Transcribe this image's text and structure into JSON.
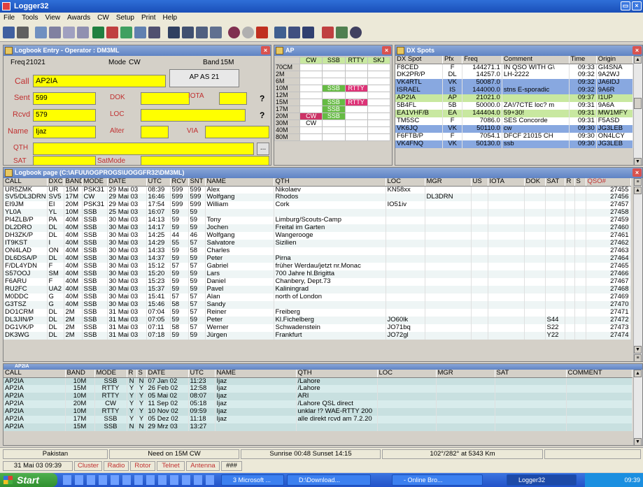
{
  "window": {
    "title": "Logger32"
  },
  "menu": [
    "File",
    "Tools",
    "View",
    "Awards",
    "CW",
    "Setup",
    "Print",
    "Help"
  ],
  "entry": {
    "title": "Logbook Entry - Operator : DM3ML",
    "freq_label": "Freq",
    "freq": "21021",
    "mode_label": "Mode",
    "mode": "CW",
    "band_label": "Band",
    "band": "15M",
    "call_label": "Call",
    "call": "AP2IA",
    "country": "AP AS 21",
    "sent_label": "Sent",
    "sent": "599",
    "rcvd_label": "Rcvd",
    "rcvd": "579",
    "name_label": "Name",
    "name": "Ijaz",
    "qth_label": "QTH",
    "sat_label": "SAT",
    "dok_label": "DOK",
    "loc_label": "LOC",
    "alter_label": "Alter",
    "iota_label": "IOTA",
    "via_label": "VIA",
    "satmode_label": "SatMode",
    "qm": "?"
  },
  "ap": {
    "title": "AP",
    "cols": [
      "CW",
      "SSB",
      "RTTY",
      "SKJ"
    ],
    "rows": [
      {
        "band": "70CM",
        "cells": [
          "",
          "",
          "",
          ""
        ]
      },
      {
        "band": "2M",
        "cells": [
          "",
          "",
          "",
          ""
        ]
      },
      {
        "band": "6M",
        "cells": [
          "",
          "",
          "",
          ""
        ]
      },
      {
        "band": "10M",
        "cells": [
          "",
          "SSB",
          "RTTY",
          ""
        ]
      },
      {
        "band": "12M",
        "cells": [
          "",
          "",
          "",
          ""
        ]
      },
      {
        "band": "15M",
        "cells": [
          "",
          "SSB",
          "RTTY",
          ""
        ]
      },
      {
        "band": "17M",
        "cells": [
          "",
          "SSB",
          "",
          ""
        ]
      },
      {
        "band": "20M",
        "cells": [
          "CW",
          "SSB",
          "",
          ""
        ]
      },
      {
        "band": "30M",
        "cells": [
          "CW",
          "",
          "",
          ""
        ]
      },
      {
        "band": "40M",
        "cells": [
          "",
          "",
          "",
          ""
        ]
      },
      {
        "band": "80M",
        "cells": [
          "",
          "",
          "",
          ""
        ]
      }
    ]
  },
  "dx": {
    "title": "DX Spots",
    "cols": [
      "DX Spot",
      "Pfx",
      "Freq",
      "Comment",
      "Time",
      "Origin"
    ],
    "rows": [
      [
        "F8CED",
        "F",
        "144271.1",
        "IN QSO WITH G\\",
        "09:33",
        "GI4SNA"
      ],
      [
        "DK2PR/P",
        "DL",
        "14257.0",
        "LH-2222",
        "09:32",
        "9A2WJ"
      ],
      [
        "VK4RTL",
        "VK",
        "50087.0",
        "",
        "09:32",
        "JA6IDJ"
      ],
      [
        "ISRAEL",
        "IS",
        "144000.0",
        "stns E-sporadic",
        "09:32",
        "9A6R"
      ],
      [
        "AP2IA",
        "AP",
        "21021.0",
        "",
        "09:37",
        "I1UP"
      ],
      [
        "5B4FL",
        "5B",
        "50000.0",
        "ZA!/7CTE loc? m",
        "09:31",
        "9A6A"
      ],
      [
        "EA1VHF/B",
        "EA",
        "144404.0",
        "59+30!",
        "09:31",
        "MW1MFY"
      ],
      [
        "TM5SC",
        "F",
        "7086.0",
        "SES Concorde",
        "09:31",
        "F5ASD"
      ],
      [
        "VK6JQ",
        "VK",
        "50110.0",
        "cw",
        "09:30",
        "JG3LEB"
      ],
      [
        "F6FTB/P",
        "F",
        "7054.1",
        "DFCF 21015 CH",
        "09:30",
        "ON4LCY"
      ],
      [
        "VK4FNQ",
        "VK",
        "50130.0",
        "ssb",
        "09:30",
        "JG3LEB"
      ]
    ]
  },
  "logbook": {
    "title": "Logbook page (C:\\AFUU\\OGPROGS\\UOGGFR32\\DM3ML)",
    "cols": [
      "CALL",
      "DXC",
      "BAND",
      "MODE",
      "DATE",
      "UTC",
      "RCV",
      "SNT",
      "NAME",
      "QTH",
      "LOC",
      "MGR",
      "US",
      "IOTA",
      "DOK",
      "SAT",
      "R",
      "S",
      "QSO#"
    ],
    "rows": [
      [
        "UR5ZMK",
        "UR",
        "15M",
        "PSK31",
        "29 Mai 03",
        "08:39",
        "599",
        "599",
        "Alex",
        "Nikolaev",
        "KN58xx",
        "",
        "",
        "",
        "",
        "",
        "",
        "",
        "27455"
      ],
      [
        "SV5/DL3DRN",
        "SV5",
        "17M",
        "CW",
        "29 Mai 03",
        "16:46",
        "599",
        "599",
        "Wolfgang",
        "Rhodos",
        "",
        "DL3DRN",
        "",
        "",
        "",
        "",
        "",
        "",
        "27456"
      ],
      [
        "EI9JM",
        "EI",
        "20M",
        "PSK31",
        "29 Mai 03",
        "17:54",
        "599",
        "599",
        "William",
        "Cork",
        "IO51iv",
        "",
        "",
        "",
        "",
        "",
        "",
        "",
        "27457"
      ],
      [
        "YL0A",
        "YL",
        "10M",
        "SSB",
        "25 Mai 03",
        "16:07",
        "59",
        "59",
        "",
        "",
        "",
        "",
        "",
        "",
        "",
        "",
        "",
        "",
        "27458"
      ],
      [
        "PI4ZLB/P",
        "PA",
        "40M",
        "SSB",
        "30 Mai 03",
        "14:13",
        "59",
        "59",
        "Tony",
        "Limburg/Scouts-Camp",
        "",
        "",
        "",
        "",
        "",
        "",
        "",
        "",
        "27459"
      ],
      [
        "DL2DRO",
        "DL",
        "40M",
        "SSB",
        "30 Mai 03",
        "14:17",
        "59",
        "59",
        "Jochen",
        "Freital im Garten",
        "",
        "",
        "",
        "",
        "",
        "",
        "",
        "",
        "27460"
      ],
      [
        "DH3ZK/P",
        "DL",
        "40M",
        "SSB",
        "30 Mai 03",
        "14:25",
        "44",
        "46",
        "Wolfgang",
        "Wangerooge",
        "",
        "",
        "",
        "",
        "",
        "",
        "",
        "",
        "27461"
      ],
      [
        "IT9KST",
        "I",
        "40M",
        "SSB",
        "30 Mai 03",
        "14:29",
        "55",
        "57",
        "Salvatore",
        "Sizilien",
        "",
        "",
        "",
        "",
        "",
        "",
        "",
        "",
        "27462"
      ],
      [
        "ON4LAD",
        "ON",
        "40M",
        "SSB",
        "30 Mai 03",
        "14:33",
        "59",
        "58",
        "Charles",
        "",
        "",
        "",
        "",
        "",
        "",
        "",
        "",
        "",
        "27463"
      ],
      [
        "DL6DSA/P",
        "DL",
        "40M",
        "SSB",
        "30 Mai 03",
        "14:37",
        "59",
        "59",
        "Peter",
        "Pirna",
        "",
        "",
        "",
        "",
        "",
        "",
        "",
        "",
        "27464"
      ],
      [
        "F/DL4YDN",
        "F",
        "40M",
        "SSB",
        "30 Mai 03",
        "15:12",
        "57",
        "57",
        "Gabriel",
        "früher Werdau/jetzt nr.Monac",
        "",
        "",
        "",
        "",
        "",
        "",
        "",
        "",
        "27465"
      ],
      [
        "S57OOJ",
        "SM",
        "40M",
        "SSB",
        "30 Mai 03",
        "15:20",
        "59",
        "59",
        "Lars",
        "700 Jahre hl.Brigitta",
        "",
        "",
        "",
        "",
        "",
        "",
        "",
        "",
        "27466"
      ],
      [
        "F6ARU",
        "F",
        "40M",
        "SSB",
        "30 Mai 03",
        "15:23",
        "59",
        "59",
        "Daniel",
        "Chanbery, Dept.73",
        "",
        "",
        "",
        "",
        "",
        "",
        "",
        "",
        "27467"
      ],
      [
        "RU2FC",
        "UA2",
        "40M",
        "SSB",
        "30 Mai 03",
        "15:37",
        "59",
        "59",
        "Pavel",
        "Kaliningrad",
        "",
        "",
        "",
        "",
        "",
        "",
        "",
        "",
        "27468"
      ],
      [
        "M0DDC",
        "G",
        "40M",
        "SSB",
        "30 Mai 03",
        "15:41",
        "57",
        "57",
        "Alan",
        "north of London",
        "",
        "",
        "",
        "",
        "",
        "",
        "",
        "",
        "27469"
      ],
      [
        "G3TSZ",
        "G",
        "40M",
        "SSB",
        "30 Mai 03",
        "15:46",
        "58",
        "57",
        "Sandy",
        "",
        "",
        "",
        "",
        "",
        "",
        "",
        "",
        "",
        "27470"
      ],
      [
        "DO1CRM",
        "DL",
        "2M",
        "SSB",
        "31 Mai 03",
        "07:04",
        "59",
        "57",
        "Reiner",
        "Freiberg",
        "",
        "",
        "",
        "",
        "",
        "",
        "",
        "",
        "27471"
      ],
      [
        "DL3JIN/P",
        "DL",
        "2M",
        "SSB",
        "31 Mai 03",
        "07:05",
        "59",
        "59",
        "Peter",
        "Kl.Fichelberg",
        "JO60lk",
        "",
        "",
        "",
        "",
        "S44",
        "",
        "",
        "27472"
      ],
      [
        "DG1VK/P",
        "DL",
        "2M",
        "SSB",
        "31 Mai 03",
        "07:11",
        "58",
        "57",
        "Werner",
        "Schwadenstein",
        "JO71bq",
        "",
        "",
        "",
        "",
        "S22",
        "",
        "",
        "27473"
      ],
      [
        "DK3WG",
        "DL",
        "2M",
        "SSB",
        "31 Mai 03",
        "07:18",
        "59",
        "59",
        "Jürgen",
        "Frankfurt",
        "JO72gl",
        "",
        "",
        "",
        "",
        "Y22",
        "",
        "",
        "27474"
      ]
    ]
  },
  "previous": {
    "title": "AP2IA",
    "cols": [
      "CALL",
      "BAND",
      "MODE",
      "R",
      "S",
      "DATE",
      "UTC",
      "NAME",
      "QTH",
      "LOC",
      "MGR",
      "SAT",
      "COMMENT"
    ],
    "rows": [
      [
        "AP2IA",
        "10M",
        "SSB",
        "N",
        "N",
        "07 Jan 02",
        "11:23",
        "Ijaz",
        "/Lahore",
        "",
        "",
        "",
        ""
      ],
      [
        "AP2IA",
        "15M",
        "RTTY",
        "Y",
        "Y",
        "26 Feb 02",
        "12:58",
        "Ijaz",
        "/Lahore",
        "",
        "",
        "",
        ""
      ],
      [
        "AP2IA",
        "10M",
        "RTTY",
        "Y",
        "Y",
        "05 Mai 02",
        "08:07",
        "Ijaz",
        "ARI",
        "",
        "",
        "",
        ""
      ],
      [
        "AP2IA",
        "20M",
        "CW",
        "Y",
        "Y",
        "11 Sep 02",
        "05:18",
        "Ijaz",
        "/Lahore QSL direct",
        "",
        "",
        "",
        ""
      ],
      [
        "AP2IA",
        "10M",
        "RTTY",
        "Y",
        "Y",
        "10 Nov 02",
        "09:59",
        "Ijaz",
        "unklar !? WAE-RTTY 200",
        "",
        "",
        "",
        ""
      ],
      [
        "AP2IA",
        "17M",
        "SSB",
        "Y",
        "Y",
        "05 Dez 02",
        "11:18",
        "Ijaz",
        "alle direkt rcvd am 7.2.20",
        "",
        "",
        "",
        ""
      ],
      [
        "AP2IA",
        "15M",
        "SSB",
        "N",
        "N",
        "29 Mrz 03",
        "13:27",
        "",
        "",
        "",
        "",
        "",
        ""
      ]
    ]
  },
  "status": {
    "country": "Pakistan",
    "need": "Need on 15M CW",
    "sun": "Sunrise 00:48 Sunset 14:15",
    "bearing": "102°/282° at 5343 Km",
    "datetime": "31 Mai 03 09:39",
    "cluster": "Cluster",
    "radio": "Radio",
    "rotor": "Rotor",
    "telnet": "Telnet",
    "antenna": "Antenna",
    "hash": "###"
  },
  "taskbar": {
    "start": "Start",
    "tasks": [
      "3 Microsoft ...",
      "D:\\Download...",
      "- Online Bro...",
      "Logger32"
    ],
    "clock": "09:39"
  },
  "colors": {
    "yellow": "#ffff00",
    "ssb": "#66bb44",
    "rtty": "#dd3377",
    "cw": "#cc3366",
    "label_red": "#c03030",
    "highlight_green": "#c8e8a0"
  }
}
